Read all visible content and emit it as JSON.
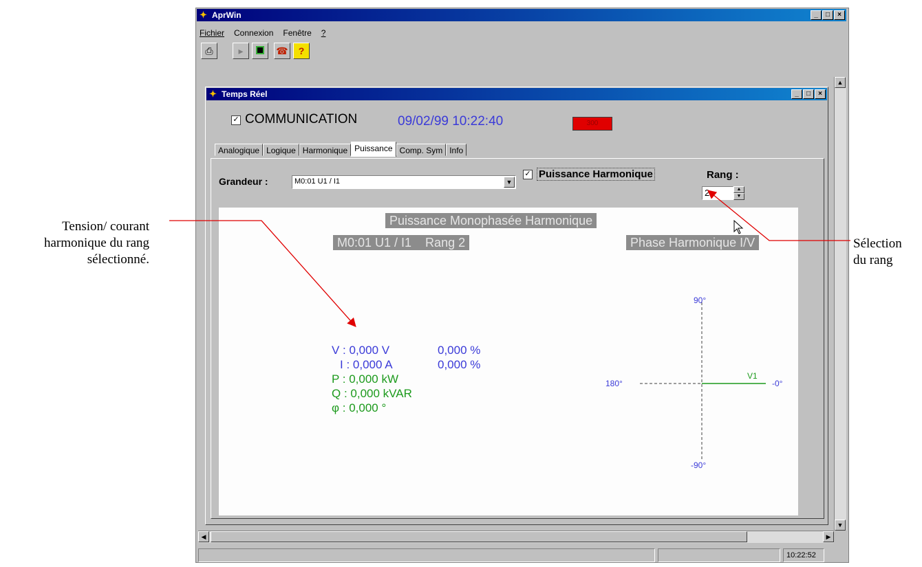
{
  "callouts": {
    "left_line1": "Tension/ courant",
    "left_line2": "harmonique du rang",
    "left_line3": "sélectionné.",
    "right_line1": "Sélection",
    "right_line2": "du rang"
  },
  "app": {
    "title": "AprWin",
    "menu": [
      "Fichier",
      "Connexion",
      "Fenêtre",
      "?"
    ]
  },
  "toolbar": {
    "icons": [
      "printer-icon",
      "play-icon",
      "stop-icon",
      "phone-icon",
      "help-icon"
    ],
    "help_label": "?"
  },
  "child": {
    "title": "Temps Réel",
    "communication_label": "COMMUNICATION",
    "datetime": "09/02/99 10:22:40",
    "indicator": "300",
    "indicator_color": "#e00000"
  },
  "tabs": [
    "Analogique",
    "Logique",
    "Harmonique",
    "Puissance",
    "Comp. Sym",
    "Info"
  ],
  "active_tab": "Puissance",
  "form": {
    "grandeur_label": "Grandeur :",
    "grandeur_value": "M0:01 U1 / I1",
    "harmonique_label": "Puissance Harmonique",
    "harmonique_checked": true,
    "rang_label": "Rang :",
    "rang_value": "2"
  },
  "display": {
    "title": "Puissance Monophasée Harmonique",
    "subtitle": "M0:01 U1 / I1    Rang 2",
    "phase_title": "Phase Harmonique I/V",
    "v_line": "V : 0,000 V",
    "v_pct": "0,000 %",
    "i_line": "I : 0,000 A",
    "i_pct": "0,000 %",
    "p_line": "P : 0,000 kW",
    "q_line": "Q : 0,000 kVAR",
    "phi_line": "φ : 0,000 °",
    "axis_90": "90°",
    "axis_m90": "-90°",
    "axis_180": "180°",
    "axis_0": "-0°",
    "vector_label": "V1"
  },
  "status": {
    "time": "10:22:52"
  },
  "colors": {
    "accent_blue": "#3a3ad8",
    "value_green": "#1c9a1c",
    "arrow_red": "#e00000"
  }
}
